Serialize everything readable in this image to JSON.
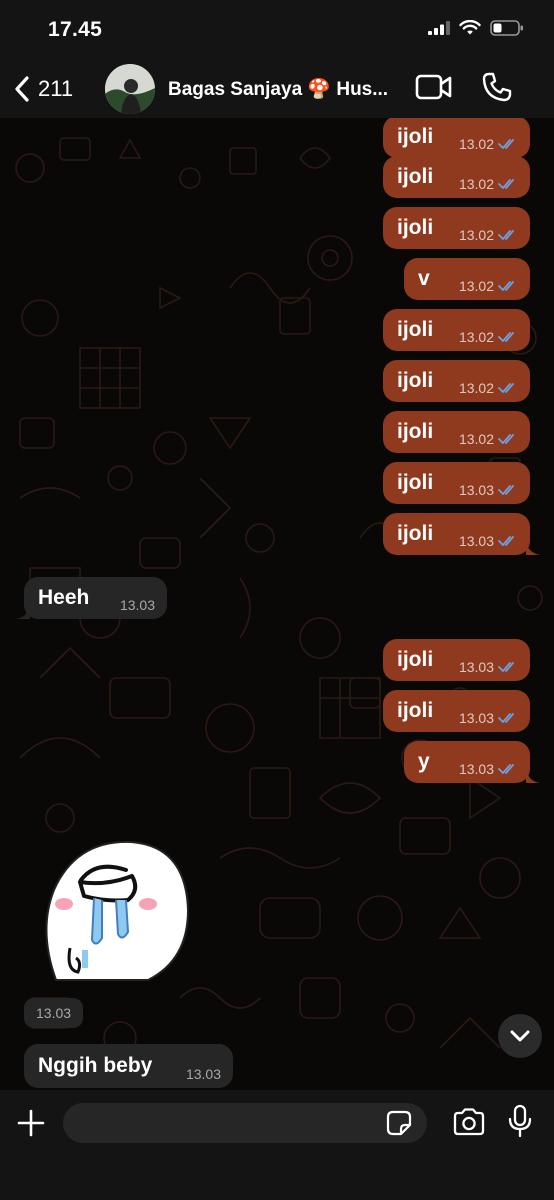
{
  "status_bar": {
    "time": "17.45"
  },
  "header": {
    "back_count": "211",
    "contact_name": "Bagas Sanjaya 🍄 Hus..."
  },
  "messages": [
    {
      "text": "ijoli",
      "time": "13.02",
      "direction": "out",
      "status": "read"
    },
    {
      "text": "ijoli",
      "time": "13.02",
      "direction": "out",
      "status": "read"
    },
    {
      "text": "ijoli",
      "time": "13.02",
      "direction": "out",
      "status": "read"
    },
    {
      "text": "v",
      "time": "13.02",
      "direction": "out",
      "status": "read"
    },
    {
      "text": "ijoli",
      "time": "13.02",
      "direction": "out",
      "status": "read"
    },
    {
      "text": "ijoli",
      "time": "13.02",
      "direction": "out",
      "status": "read"
    },
    {
      "text": "ijoli",
      "time": "13.02",
      "direction": "out",
      "status": "read"
    },
    {
      "text": "ijoli",
      "time": "13.03",
      "direction": "out",
      "status": "read"
    },
    {
      "text": "ijoli",
      "time": "13.03",
      "direction": "out",
      "status": "read"
    },
    {
      "text": "Heeh",
      "time": "13.03",
      "direction": "in"
    },
    {
      "text": "ijoli",
      "time": "13.03",
      "direction": "out",
      "status": "read"
    },
    {
      "text": "ijoli",
      "time": "13.03",
      "direction": "out",
      "status": "read"
    },
    {
      "text": "y",
      "time": "13.03",
      "direction": "out",
      "status": "read"
    },
    {
      "text": "Nggih beby",
      "time": "13.03",
      "direction": "in"
    }
  ],
  "sticker": {
    "time": "13.03",
    "icon": "crying-sticker"
  },
  "input_bar": {
    "placeholder": ""
  },
  "colors": {
    "outgoing_bubble": "#8f3a1e",
    "incoming_bubble": "#262626",
    "read_ticks": "#6f9fe0",
    "background": "#0a0807"
  }
}
